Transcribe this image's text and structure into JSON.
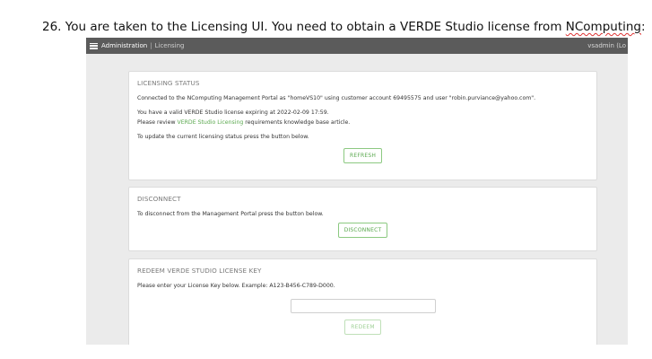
{
  "doc": {
    "step_prefix": "26.  You are taken to the Licensing UI.  You need to obtain a VERDE Studio license from ",
    "step_company": "NComputing",
    "step_suffix": ":"
  },
  "topbar": {
    "admin": "Administration",
    "separator": "|",
    "page": "Licensing",
    "user": "vsadmin  (Lo"
  },
  "status": {
    "heading": "LICENSING STATUS",
    "connected": "Connected to the NComputing Management Portal as \"homeVS10\" using customer account 69495575 and user \"robin.purviance@yahoo.com\".",
    "valid": "You have a valid VERDE Studio license expiring at 2022-02-09 17:59.",
    "review_prefix": "Please review ",
    "review_link": "VERDE Studio Licensing",
    "review_suffix": " requirements knowledge base article.",
    "update": "To update the current licensing status press the button below.",
    "refresh_label": "REFRESH"
  },
  "disconnect": {
    "heading": "DISCONNECT",
    "text": "To disconnect from the Management Portal press the button below.",
    "button_label": "DISCONNECT"
  },
  "redeem": {
    "heading": "REDEEM VERDE STUDIO LICENSE KEY",
    "text": "Please enter your License Key below. Example: A123-B456-C789-D000.",
    "input_value": "",
    "button_label": "REDEEM"
  }
}
